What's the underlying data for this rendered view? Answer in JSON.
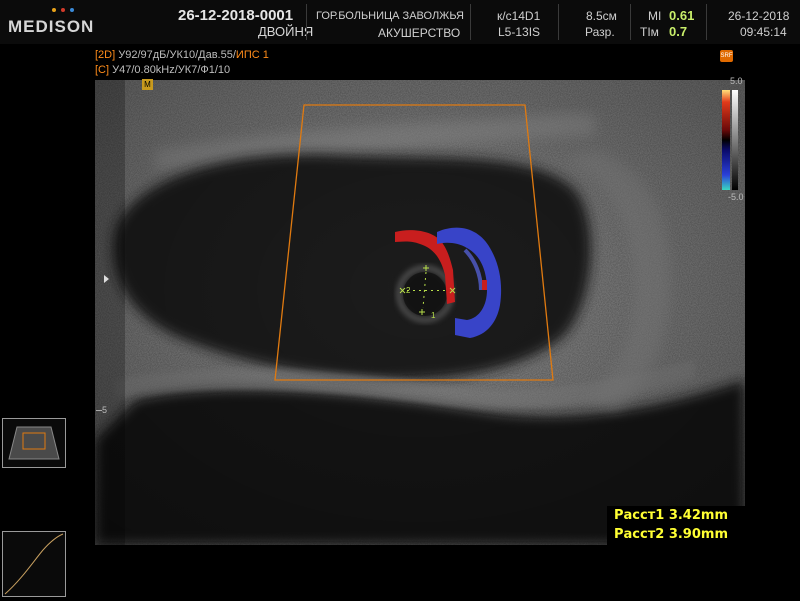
{
  "header": {
    "brand": "MEDISON",
    "brand_dot_colors": [
      "#e8a21a",
      "#d23a2a",
      "#3a8ad8"
    ],
    "study_id": "26-12-2018-0001",
    "study_type": "ДВОЙНЯ",
    "hospital": "ГОР.БОЛЬНИЦА ЗАВОЛЖЬЯ",
    "department": "АКУШЕРСТВО",
    "probe_label": "к/с14D1",
    "probe_id": "L5-13IS",
    "depth": "8.5см",
    "resolution": "Разр.",
    "mi_label": "MI",
    "mi_value": "0.61",
    "ti_label": "TIм",
    "ti_value": "0.7",
    "date": "26-12-2018",
    "time": "09:45:14"
  },
  "modes": {
    "line1_tag": "[2D]",
    "line1_text": " У92/97дБ/УК10/Дав.55/",
    "line1_tail": "ИПС 1",
    "line2_tag": "[C]",
    "line2_text": " У47/0.80kHz/УК7/Ф1/10"
  },
  "markers": {
    "focus_box": "M",
    "srf": "SRF",
    "depth_scale": "5",
    "caliper1": "1",
    "caliper2": "2"
  },
  "color_scale": {
    "top": "5.0",
    "bottom": "-5.0"
  },
  "measurements": [
    {
      "label": "Расст1",
      "value": "3.42mm"
    },
    {
      "label": "Расст2",
      "value": "3.90mm"
    }
  ],
  "colors": {
    "roi_box": "#e07a10",
    "measurement_text": "#ffff33",
    "index_values": "#c8ee6a",
    "doppler_red": "#c81e1e",
    "doppler_blue": "#3844c8"
  }
}
